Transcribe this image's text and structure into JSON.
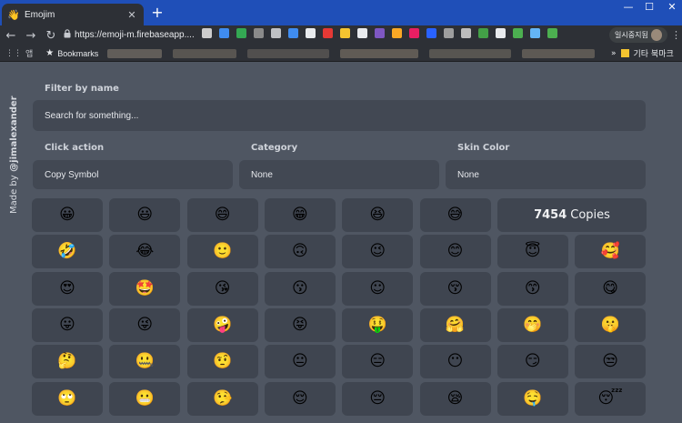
{
  "browser": {
    "tab_title": "Emojim",
    "tab_favicon": "👋",
    "close_glyph": "✕",
    "new_tab_glyph": "+",
    "url": "https://emoji-m.firebaseapp....",
    "profile_label": "일시중지됨",
    "window_controls": {
      "minimize": "—",
      "maximize": "☐",
      "close": "✕"
    },
    "nav": {
      "back": "←",
      "forward": "→",
      "reload": "↻"
    },
    "menu_glyph": "⋮",
    "extension_colors": [
      "#cccccc",
      "#3f8cf0",
      "#34a853",
      "#8a8a8a",
      "#bfc1c5",
      "#3f8cf0",
      "#e8eaed",
      "#e53935",
      "#f4c430",
      "#e8eaed",
      "#7e57c2",
      "#f9a825",
      "#e91e63",
      "#2962ff",
      "#9e9e9e",
      "#bdbdbd",
      "#43a047",
      "#e8eaed",
      "#4caf50",
      "#64b5f6",
      "#4caf50"
    ]
  },
  "bookmarks": {
    "apps_label": "앱",
    "apps_icon": "⋮⋮",
    "bookmarks_label": "Bookmarks",
    "star_glyph": "★",
    "more_glyph": "»",
    "other_bookmarks_label": "기타 북마크"
  },
  "page": {
    "made_by_prefix": "Made by",
    "made_by_author": "@jimalexander",
    "filter_label": "Filter by name",
    "search_placeholder": "Search for something...",
    "click_action_label": "Click action",
    "click_action_value": "Copy Symbol",
    "category_label": "Category",
    "category_value": "None",
    "skin_color_label": "Skin Color",
    "skin_color_value": "None",
    "copies_count": "7454",
    "copies_label": "Copies"
  },
  "emoji_grid": [
    [
      "😀",
      "😃",
      "😄",
      "😁",
      "😆",
      "😅"
    ],
    [
      "🤣",
      "😂",
      "🙂",
      "🙃",
      "😉",
      "😊",
      "😇",
      "🥰"
    ],
    [
      "😍",
      "🤩",
      "😘",
      "😗",
      "☺",
      "😚",
      "😙",
      "😋"
    ],
    [
      "😛",
      "😜",
      "🤪",
      "😝",
      "🤑",
      "🤗",
      "🤭",
      "🤫"
    ],
    [
      "🤔",
      "🤐",
      "🤨",
      "😐",
      "😑",
      "😶",
      "😏",
      "😒"
    ],
    [
      "🙄",
      "😬",
      "🤥",
      "😌",
      "😔",
      "😪",
      "🤤",
      "😴"
    ]
  ]
}
